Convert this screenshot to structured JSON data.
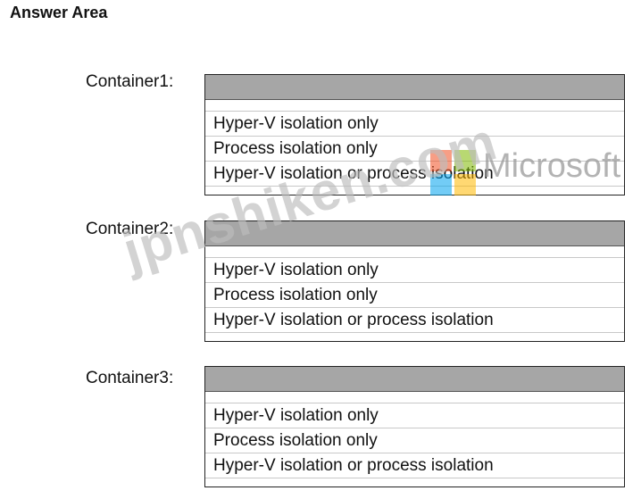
{
  "header": {
    "title": "Answer Area"
  },
  "containers": [
    {
      "label": "Container1:",
      "options": [
        "Hyper-V isolation only",
        "Process isolation only",
        "Hyper-V isolation or process isolation"
      ]
    },
    {
      "label": "Container2:",
      "options": [
        "Hyper-V isolation only",
        "Process isolation only",
        "Hyper-V isolation or process isolation"
      ]
    },
    {
      "label": "Container3:",
      "options": [
        "Hyper-V isolation only",
        "Process isolation only",
        "Hyper-V isolation or process isolation"
      ]
    }
  ],
  "watermark": {
    "brand": "Microsoft",
    "site": "jpnshiken.com",
    "logo_colors": [
      "#f25022",
      "#7fba00",
      "#00a4ef",
      "#ffb900"
    ]
  },
  "colors": {
    "dropdown_header": "#a6a6a6",
    "border": "#222222"
  }
}
